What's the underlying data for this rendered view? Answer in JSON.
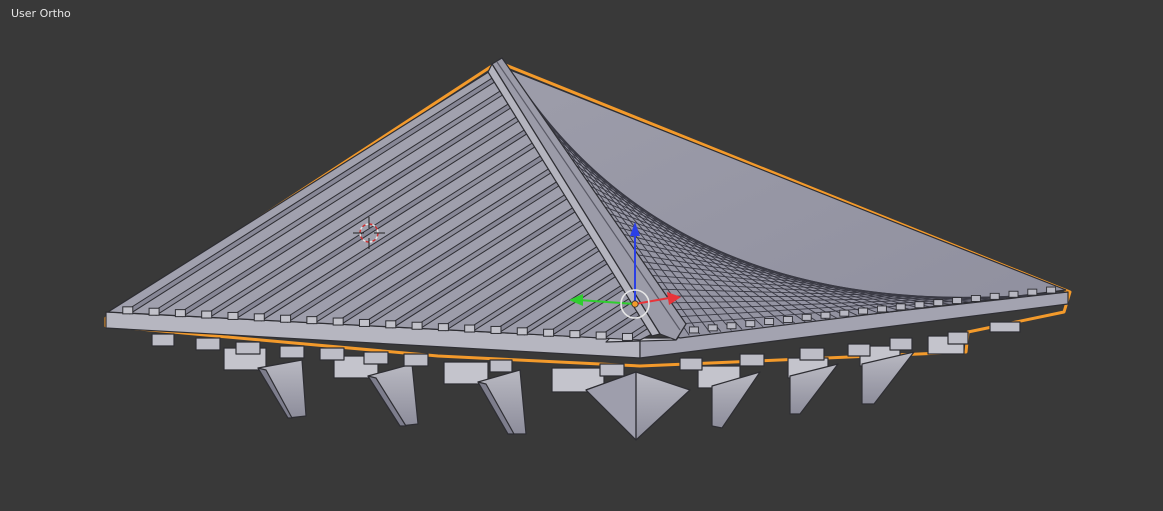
{
  "viewport": {
    "view_label": "User Ortho"
  },
  "colors": {
    "background": "#393939",
    "mesh_face": "#a9a9b4",
    "mesh_edge": "#2e2e33",
    "selection_outline": "#f39a2b",
    "axis_x": "#e8343a",
    "axis_y": "#2fce2f",
    "axis_z": "#2a3fe6",
    "cursor_ring": "#c8c8c8",
    "cursor_dash": "#d03030"
  },
  "icons": {
    "cursor": "3d-cursor-icon",
    "gizmo": "transform-gizmo-icon"
  }
}
